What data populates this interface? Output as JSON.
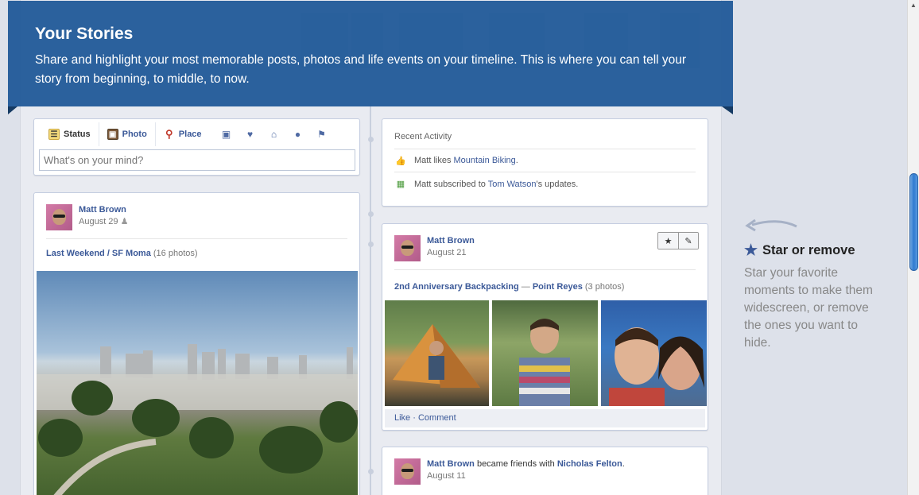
{
  "banner": {
    "title": "Your Stories",
    "text": "Share and highlight your most memorable posts, photos and life events on your timeline. This is where you can tell your story from beginning, to middle, to now."
  },
  "composer": {
    "tabs": [
      {
        "label": "Status",
        "icon": "status-icon"
      },
      {
        "label": "Photo",
        "icon": "photo-icon"
      },
      {
        "label": "Place",
        "icon": "place-icon"
      }
    ],
    "extra_icons": [
      "home-icon",
      "heart-icon",
      "house-icon",
      "apple-icon",
      "flag-icon"
    ],
    "placeholder": "What's on your mind?"
  },
  "recent_activity": {
    "title": "Recent Activity",
    "items": [
      {
        "prefix": "Matt likes ",
        "link": "Mountain Biking",
        "suffix": "."
      },
      {
        "prefix": "Matt subscribed to ",
        "link": "Tom Watson",
        "suffix": "'s updates."
      }
    ]
  },
  "left_story": {
    "author": "Matt Brown",
    "date": "August 29",
    "album_title": "Last Weekend / SF Moma",
    "album_count": "(16 photos)"
  },
  "right_story": {
    "author": "Matt Brown",
    "date": "August 21",
    "album_title": "2nd Anniversary Backpacking",
    "separator": " — ",
    "place": "Point Reyes",
    "album_count": "(3 photos)",
    "actions": {
      "like": "Like",
      "dot": " · ",
      "comment": "Comment"
    }
  },
  "friends_story": {
    "author": "Matt Brown",
    "middle": " became friends with ",
    "friend": "Nicholas Felton",
    "end": ".",
    "date": "August 11"
  },
  "tip": {
    "title": "Star or remove",
    "text": "Star your favorite moments to make them widescreen, or remove the ones you want to hide."
  },
  "colors": {
    "banner": "#245c9a",
    "link": "#3b5998",
    "page_bg": "#e9ebf1"
  }
}
